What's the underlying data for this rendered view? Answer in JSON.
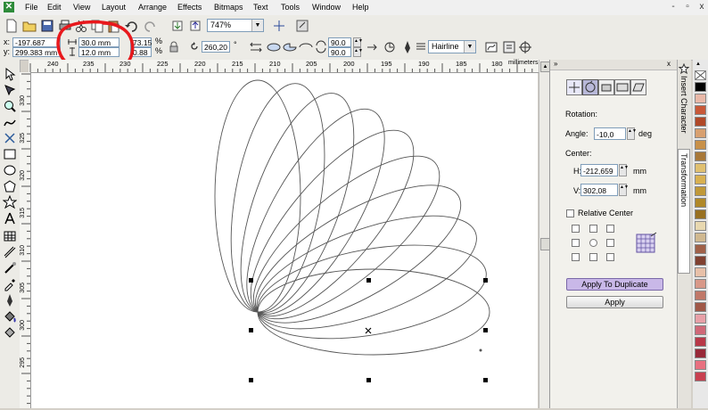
{
  "menubar": {
    "items": [
      "File",
      "Edit",
      "View",
      "Layout",
      "Arrange",
      "Effects",
      "Bitmaps",
      "Text",
      "Tools",
      "Window",
      "Help"
    ],
    "window_controls": [
      "-",
      "▫",
      "x"
    ]
  },
  "toolbar": {
    "zoom": "747%"
  },
  "property_bar": {
    "x_label": "x:",
    "y_label": "y:",
    "x_value": "-197.687 mm",
    "y_value": "299.383 mm",
    "width_value": "30.0 mm",
    "height_value": "12.0 mm",
    "scale_x": "73.15",
    "scale_y": "0.88",
    "percent": "%",
    "rotation_value": "260,20",
    "degree": "°",
    "start_angle": "90.0",
    "end_angle": "90.0",
    "outline": "Hairline"
  },
  "ruler": {
    "h_ticks": [
      "240",
      "235",
      "230",
      "225",
      "220",
      "215",
      "210",
      "205",
      "200",
      "195",
      "190",
      "185",
      "180"
    ],
    "units": "millimeters",
    "v_ticks": [
      "330",
      "325",
      "320",
      "315",
      "310",
      "305",
      "300",
      "295"
    ]
  },
  "docker": {
    "rotation_title": "Rotation:",
    "angle_label": "Angle:",
    "angle_value": "-10,0",
    "angle_unit": "deg",
    "center_title": "Center:",
    "h_label": "H:",
    "h_value": "-212,659",
    "v_label": "V:",
    "v_value": "302,08",
    "mm": "mm",
    "relative_center": "Relative Center",
    "apply_to_duplicate": "Apply To Duplicate",
    "apply": "Apply",
    "tab_insert_character": "Insert Character",
    "tab_transformation": "Transformation"
  },
  "colors": {
    "annotation": "#e8181c",
    "selected_button": "#c9b8e8"
  },
  "palette": [
    "#ffffff",
    "#000000",
    "#e9b8a8",
    "#c85838",
    "#b04828",
    "#d8a070",
    "#c89048",
    "#a87838",
    "#e0c070",
    "#d8b050",
    "#c09838",
    "#b08828",
    "#987020",
    "#e8d8b0",
    "#d0b890",
    "#a06048",
    "#804030",
    "#e8c0a8",
    "#d89888",
    "#c07868",
    "#a05848",
    "#e8a0a8",
    "#d06878",
    "#b83848",
    "#982838",
    "#e87080",
    "#c84050"
  ]
}
